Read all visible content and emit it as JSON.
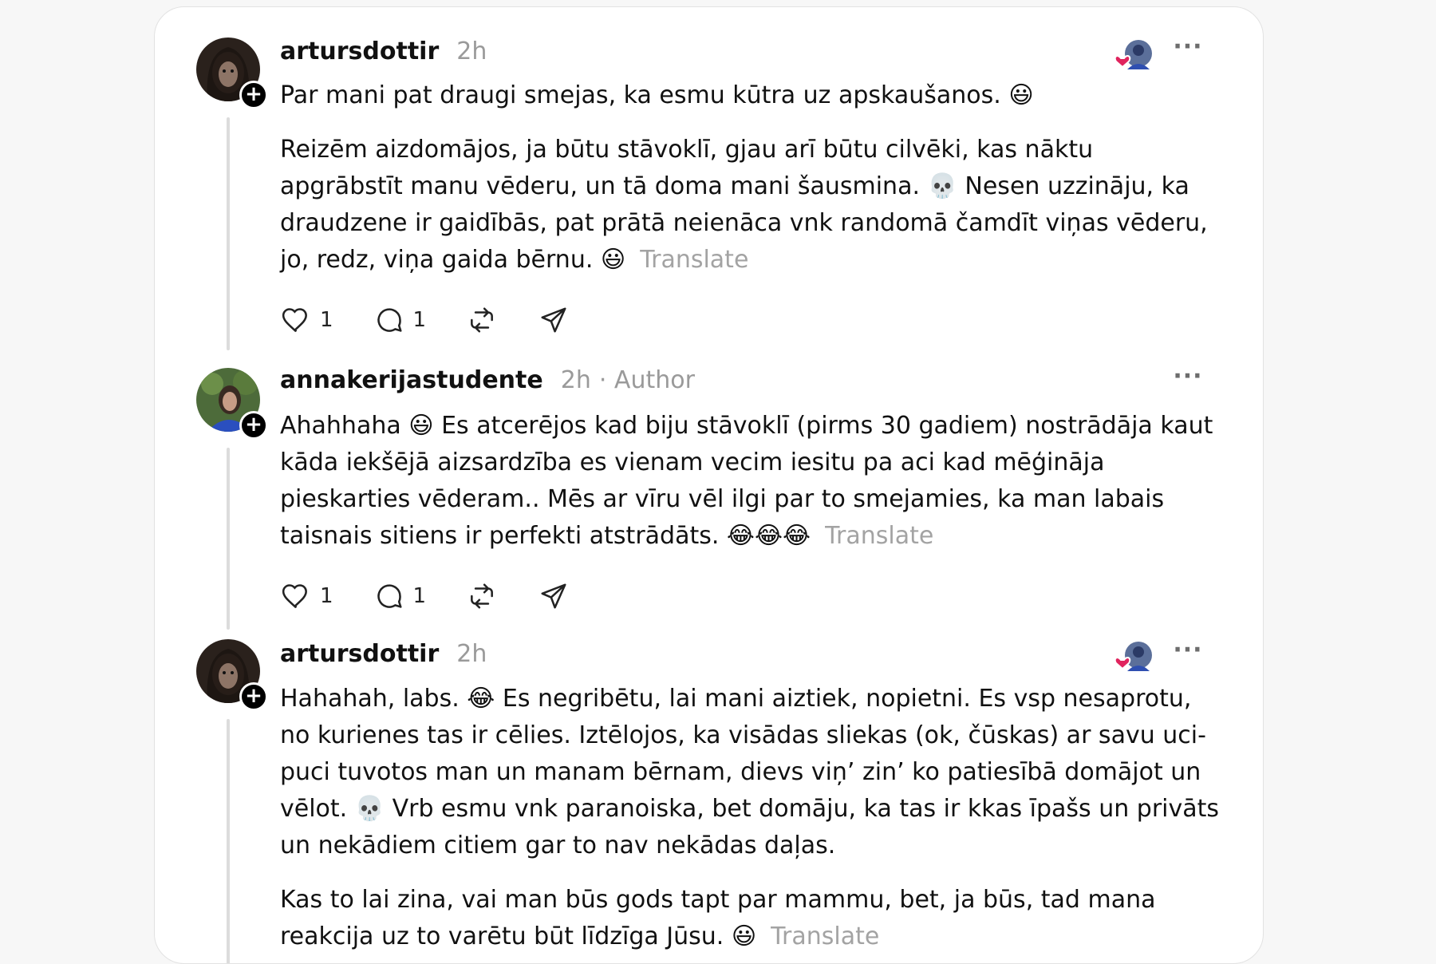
{
  "thread": {
    "posts": [
      {
        "username": "artursdottir",
        "time": "2h",
        "paragraphs": [
          "Par mani pat draugi smejas, ka esmu kūtra uz apskaušanos. 😃",
          "Reizēm aizdomājos, ja būtu stāvoklī, gjau arī būtu cilvēki, kas nāktu apgrābstīt manu vēderu, un tā doma mani šausmina. 💀 Nesen uzzināju, ka draudzene ir gaidībās, pat prātā neienāca vnk randomā čamdīt viņas vēderu, jo, redz, viņa gaida bērnu. 😃"
        ],
        "translate_label": "Translate",
        "likes": "1",
        "replies": "1"
      },
      {
        "username": "annakerijastudente",
        "time": "2h",
        "author_label": "· Author",
        "paragraphs": [
          "Ahahhaha 😃 Es atcerējos kad biju stāvoklī (pirms 30 gadiem) nostrādāja kaut kāda iekšējā aizsardzība es vienam vecim iesitu pa aci kad mēģināja pieskarties vēderam.. Mēs ar vīru vēl ilgi par to smejamies, ka man labais taisnais sitiens ir perfekti atstrādāts. 😂😂😂"
        ],
        "translate_label": "Translate",
        "likes": "1",
        "replies": "1"
      },
      {
        "username": "artursdottir",
        "time": "2h",
        "paragraphs": [
          "Hahahah, labs. 😂 Es negribētu, lai mani aiztiek, nopietni. Es vsp nesaprotu, no kurienes tas ir cēlies. Iztēlojos, ka visādas sliekas (ok, čūskas) ar savu uci-puci tuvotos man un manam bērnam, dievs viņ’ zin’ ko patiesībā domājot un vēlot. 💀 Vrb esmu vnk paranoiska, bet domāju, ka tas ir kkas īpašs un privāts un nekādiem citiem gar to nav nekādas daļas.",
          "Kas to lai zina, vai man būs gods tapt par mammu, bet, ja būs, tad mana reakcija uz to varētu būt līdzīga Jūsu. 😃"
        ],
        "translate_label": "Translate"
      }
    ]
  },
  "colors": {
    "meta": "#9a9a9a",
    "text": "#111111",
    "thread_line": "#dcdcdc",
    "heart": "#e0245e"
  }
}
